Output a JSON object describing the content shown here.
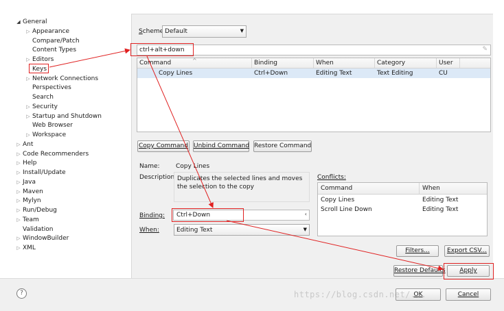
{
  "tree": {
    "items": [
      {
        "label": "General",
        "expander": "open",
        "level": 0
      },
      {
        "label": "Appearance",
        "expander": "closed",
        "level": 1
      },
      {
        "label": "Compare/Patch",
        "expander": "none",
        "level": 1
      },
      {
        "label": "Content Types",
        "expander": "none",
        "level": 1
      },
      {
        "label": "Editors",
        "expander": "closed",
        "level": 1
      },
      {
        "label": "Keys",
        "expander": "none",
        "level": 1
      },
      {
        "label": "Network Connections",
        "expander": "closed",
        "level": 1
      },
      {
        "label": "Perspectives",
        "expander": "none",
        "level": 1
      },
      {
        "label": "Search",
        "expander": "none",
        "level": 1
      },
      {
        "label": "Security",
        "expander": "closed",
        "level": 1
      },
      {
        "label": "Startup and Shutdown",
        "expander": "closed",
        "level": 1
      },
      {
        "label": "Web Browser",
        "expander": "none",
        "level": 1
      },
      {
        "label": "Workspace",
        "expander": "closed",
        "level": 1
      },
      {
        "label": "Ant",
        "expander": "closed",
        "level": 0
      },
      {
        "label": "Code Recommenders",
        "expander": "closed",
        "level": 0
      },
      {
        "label": "Help",
        "expander": "closed",
        "level": 0
      },
      {
        "label": "Install/Update",
        "expander": "closed",
        "level": 0
      },
      {
        "label": "Java",
        "expander": "closed",
        "level": 0
      },
      {
        "label": "Maven",
        "expander": "closed",
        "level": 0
      },
      {
        "label": "Mylyn",
        "expander": "closed",
        "level": 0
      },
      {
        "label": "Run/Debug",
        "expander": "closed",
        "level": 0
      },
      {
        "label": "Team",
        "expander": "closed",
        "level": 0
      },
      {
        "label": "Validation",
        "expander": "none",
        "level": 0
      },
      {
        "label": "WindowBuilder",
        "expander": "closed",
        "level": 0
      },
      {
        "label": "XML",
        "expander": "closed",
        "level": 0
      }
    ]
  },
  "scheme": {
    "label": "Scheme:",
    "value": "Default"
  },
  "filter": {
    "value": "ctrl+alt+down"
  },
  "commands_table": {
    "headers": [
      "Command",
      "Binding",
      "When",
      "Category",
      "User"
    ],
    "rows": [
      [
        "Copy Lines",
        "Ctrl+Down",
        "Editing Text",
        "Text Editing",
        "CU"
      ]
    ]
  },
  "buttons": {
    "copy_command": "Copy Command",
    "unbind_command": "Unbind Command",
    "restore_command": "Restore Command",
    "filters": "Filters...",
    "export_csv": "Export CSV...",
    "restore_defaults": "Restore Defaults",
    "apply": "Apply",
    "ok": "OK",
    "cancel": "Cancel"
  },
  "details": {
    "name_label": "Name:",
    "name_value": "Copy Lines",
    "description_label": "Description:",
    "description_value": "Duplicates the selected lines and moves the selection to the copy",
    "binding_label": "Binding:",
    "binding_value": "Ctrl+Down",
    "when_label": "When:",
    "when_value": "Editing Text"
  },
  "conflicts": {
    "label": "Conflicts:",
    "headers": [
      "Command",
      "When"
    ],
    "rows": [
      [
        "Copy Lines",
        "Editing Text"
      ],
      [
        "Scroll Line Down",
        "Editing Text"
      ]
    ]
  },
  "help_icon": "?",
  "watermark": "https://blog.csdn.net/...",
  "colors": {
    "annotation": "#e02020",
    "selected_row": "#dce9f7",
    "dialog_bg": "#f0f0f0"
  },
  "icons": {
    "help": "help-icon",
    "dropdown": "chevron-down-icon",
    "filter_clear": "clear-filter-icon"
  }
}
